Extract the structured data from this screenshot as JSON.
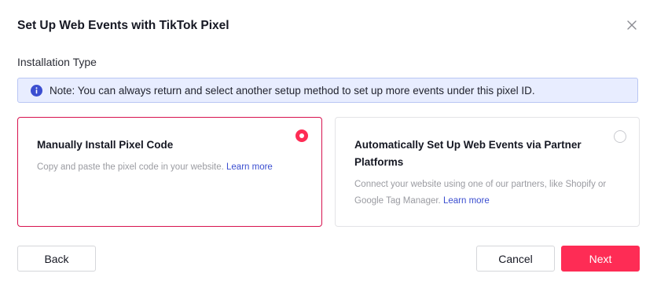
{
  "dialog": {
    "title": "Set Up Web Events with TikTok Pixel",
    "close_icon": "close-icon"
  },
  "section": {
    "label": "Installation Type"
  },
  "note": {
    "icon": "info-icon",
    "text": "Note: You can always return and select another setup method to set up more events under this pixel ID."
  },
  "options": [
    {
      "title": "Manually Install Pixel Code",
      "description": "Copy and paste the pixel code in your website.",
      "link": "Learn more",
      "selected": true
    },
    {
      "title": "Automatically Set Up Web Events via Partner Platforms",
      "description": "Connect your website using one of our partners, like Shopify or Google Tag Manager.",
      "link": "Learn more",
      "selected": false
    }
  ],
  "footer": {
    "back_label": "Back",
    "cancel_label": "Cancel",
    "next_label": "Next"
  },
  "colors": {
    "primary": "#fe2c55",
    "selected_border": "#d7124f",
    "link": "#3b4ed0",
    "note_bg": "#e8edff",
    "note_border": "#b9c6f4"
  }
}
